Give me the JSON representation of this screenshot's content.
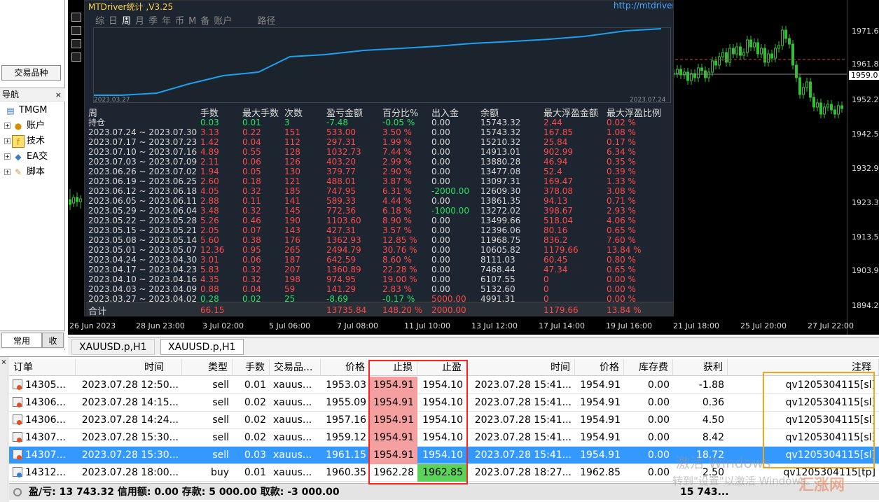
{
  "left_panel": {
    "symbols_button": "交易品种",
    "nav_title": "导航",
    "nav_close": "×",
    "nav_items": [
      {
        "label": "TMGM",
        "icon": "server-icon"
      },
      {
        "label": "账户",
        "icon": "accounts-icon"
      },
      {
        "label": "技术",
        "icon": "indicators-icon"
      },
      {
        "label": "EA交",
        "icon": "expert-advisor-icon"
      },
      {
        "label": "脚本",
        "icon": "scripts-icon"
      }
    ],
    "tabs": [
      "常用",
      "收"
    ]
  },
  "chart": {
    "price_labels": [
      "1971.6",
      "1961.8",
      "1959.0",
      "1952.2",
      "1942.5",
      "1932.9",
      "1923.3",
      "1913.5",
      "1903.9",
      "1894.2"
    ],
    "time_labels": [
      "26 Jun 2023",
      "28 Jun 23:00",
      "3 Jul 02:00",
      "5 Jul 06:00",
      "7 Jul 08:00",
      "11 Jul 10:00",
      "13 Jul 12:00",
      "17 Jul 14:00",
      "19 Jul 16:00",
      "21 Jul 18:00",
      "25 Jul 20:00",
      "27 Jul 22:00"
    ],
    "tabs": [
      "XAUUSD.p,H1",
      "XAUUSD.p,H1"
    ]
  },
  "stats": {
    "title": "MTDriver统计 ,V3.25",
    "url": "http://mtdriver.cn",
    "tabs": [
      "综",
      "日",
      "周",
      "月",
      "季",
      "年",
      "币",
      "M",
      "备",
      "账户",
      "路径"
    ],
    "graph_start": "2023.03.27",
    "graph_end": "2023.07.24",
    "headers": [
      "周",
      "手数",
      "最大手数",
      "次数",
      "盈亏金额",
      "百分比%",
      "出入金",
      "余额",
      "最大浮盈金额",
      "最大浮盈比例"
    ],
    "holding": {
      "label": "持仓",
      "lots": "0.03",
      "max": "0.01",
      "count": "3",
      "pl": "-7.48",
      "pct": "-0.05 %",
      "io": "0.00",
      "bal": "15743.32",
      "fl": "2.44",
      "flp": "0.02 %"
    },
    "rows": [
      {
        "period": "2023.07.24 ~ 2023.07.30",
        "lots": "3.13",
        "max": "0.22",
        "count": "151",
        "pl": "533.00",
        "pct": "3.50 %",
        "io": "0.00",
        "bal": "15743.32",
        "fl": "167.85",
        "flp": "1.08 %"
      },
      {
        "period": "2023.07.17 ~ 2023.07.23",
        "lots": "1.42",
        "max": "0.04",
        "count": "112",
        "pl": "297.31",
        "pct": "1.99 %",
        "io": "0.00",
        "bal": "15210.32",
        "fl": "25.84",
        "flp": "0.17 %"
      },
      {
        "period": "2023.07.10 ~ 2023.07.16",
        "lots": "4.89",
        "max": "0.55",
        "count": "128",
        "pl": "1032.73",
        "pct": "7.44 %",
        "io": "0.00",
        "bal": "14913.01",
        "fl": "902.99",
        "flp": "6.34 %"
      },
      {
        "period": "2023.07.03 ~ 2023.07.09",
        "lots": "2.11",
        "max": "0.06",
        "count": "126",
        "pl": "403.20",
        "pct": "2.99 %",
        "io": "0.00",
        "bal": "13880.28",
        "fl": "46.94",
        "flp": "0.35 %"
      },
      {
        "period": "2023.06.26 ~ 2023.07.02",
        "lots": "1.94",
        "max": "0.05",
        "count": "130",
        "pl": "379.77",
        "pct": "2.90 %",
        "io": "0.00",
        "bal": "13477.08",
        "fl": "52.4",
        "flp": "0.39 %"
      },
      {
        "period": "2023.06.19 ~ 2023.06.25",
        "lots": "2.60",
        "max": "0.18",
        "count": "121",
        "pl": "488.01",
        "pct": "3.87 %",
        "io": "0.00",
        "bal": "13097.31",
        "fl": "169.47",
        "flp": "1.33 %"
      },
      {
        "period": "2023.06.12 ~ 2023.06.18",
        "lots": "4.05",
        "max": "0.32",
        "count": "185",
        "pl": "747.95",
        "pct": "6.31 %",
        "io": "-2000.00",
        "bal": "12609.30",
        "fl": "378.08",
        "flp": "3.08 %"
      },
      {
        "period": "2023.06.05 ~ 2023.06.11",
        "lots": "2.88",
        "max": "0.11",
        "count": "141",
        "pl": "589.33",
        "pct": "4.44 %",
        "io": "0.00",
        "bal": "13861.35",
        "fl": "94.13",
        "flp": "0.71 %"
      },
      {
        "period": "2023.05.29 ~ 2023.06.04",
        "lots": "3.48",
        "max": "0.32",
        "count": "145",
        "pl": "772.36",
        "pct": "6.18 %",
        "io": "-1000.00",
        "bal": "13272.02",
        "fl": "398.67",
        "flp": "2.93 %"
      },
      {
        "period": "2023.05.22 ~ 2023.05.28",
        "lots": "5.26",
        "max": "0.46",
        "count": "190",
        "pl": "1103.60",
        "pct": "8.90 %",
        "io": "0.00",
        "bal": "13499.66",
        "fl": "518.04",
        "flp": "4.06 %"
      },
      {
        "period": "2023.05.15 ~ 2023.05.21",
        "lots": "2.05",
        "max": "0.07",
        "count": "143",
        "pl": "427.31",
        "pct": "3.57 %",
        "io": "0.00",
        "bal": "12396.06",
        "fl": "80.16",
        "flp": "0.65 %"
      },
      {
        "period": "2023.05.08 ~ 2023.05.14",
        "lots": "5.60",
        "max": "0.38",
        "count": "176",
        "pl": "1362.93",
        "pct": "12.85 %",
        "io": "0.00",
        "bal": "11968.75",
        "fl": "836.2",
        "flp": "7.60 %"
      },
      {
        "period": "2023.05.01 ~ 2023.05.07",
        "lots": "12.36",
        "max": "0.95",
        "count": "265",
        "pl": "2494.79",
        "pct": "30.76 %",
        "io": "0.00",
        "bal": "10605.82",
        "fl": "1179.66",
        "flp": "13.84 %"
      },
      {
        "period": "2023.04.24 ~ 2023.04.30",
        "lots": "3.01",
        "max": "0.06",
        "count": "187",
        "pl": "642.59",
        "pct": "8.60 %",
        "io": "0.00",
        "bal": "8111.03",
        "fl": "60.45",
        "flp": "0.80 %"
      },
      {
        "period": "2023.04.17 ~ 2023.04.23",
        "lots": "5.83",
        "max": "0.32",
        "count": "207",
        "pl": "1360.89",
        "pct": "22.28 %",
        "io": "0.00",
        "bal": "7468.44",
        "fl": "47.34",
        "flp": "0.65 %"
      },
      {
        "period": "2023.04.10 ~ 2023.04.16",
        "lots": "4.35",
        "max": "0.32",
        "count": "198",
        "pl": "974.95",
        "pct": "19.00 %",
        "io": "0.00",
        "bal": "6107.55",
        "fl": "0",
        "flp": "0.00 %"
      },
      {
        "period": "2023.04.03 ~ 2023.04.09",
        "lots": "0.88",
        "max": "0.04",
        "count": "59",
        "pl": "141.29",
        "pct": "2.83 %",
        "io": "0.00",
        "bal": "5132.60",
        "fl": "0",
        "flp": "0.00 %"
      },
      {
        "period": "2023.03.27 ~ 2023.04.02",
        "lots": "0.28",
        "max": "0.02",
        "count": "25",
        "pl": "-8.69",
        "pct": "-0.17 %",
        "io": "5000.00",
        "bal": "4991.31",
        "fl": "0",
        "flp": "0.00 %"
      }
    ],
    "total": {
      "label": "合计",
      "lots": "66.15",
      "pl": "13735.84",
      "pct": "148.20 %",
      "io": "2000.00",
      "fl": "1179.66",
      "flp": "13.84 %"
    }
  },
  "table": {
    "headers": {
      "order": "订单",
      "time": "时间",
      "type": "类型",
      "lots": "手数",
      "symbol": "交易品...",
      "price": "价格",
      "sl": "止损",
      "tp": "止盈",
      "time2": "时间",
      "price2": "价格",
      "swap": "库存费",
      "profit": "获利",
      "comment": "注释"
    },
    "rows": [
      {
        "order": "14305...",
        "time": "2023.07.28 12:50...",
        "type": "sell",
        "lots": "0.01",
        "symbol": "xauus...",
        "price": "1953.03",
        "sl": "1954.91",
        "tp": "1954.10",
        "time2": "2023.07.28 15:41...",
        "price2": "1954.91",
        "swap": "0.00",
        "profit": "-1.88",
        "comment": "qv1205304115[sl]"
      },
      {
        "order": "14306...",
        "time": "2023.07.28 14:15...",
        "type": "sell",
        "lots": "0.02",
        "symbol": "xauus...",
        "price": "1955.09",
        "sl": "1954.91",
        "tp": "1954.10",
        "time2": "2023.07.28 15:41...",
        "price2": "1954.91",
        "swap": "0.00",
        "profit": "0.36",
        "comment": "qv1205304115[sl]"
      },
      {
        "order": "14306...",
        "time": "2023.07.28 14:24...",
        "type": "sell",
        "lots": "0.02",
        "symbol": "xauus...",
        "price": "1957.16",
        "sl": "1954.91",
        "tp": "1954.10",
        "time2": "2023.07.28 15:41...",
        "price2": "1954.91",
        "swap": "0.00",
        "profit": "4.50",
        "comment": "qv1205304115[sl]"
      },
      {
        "order": "14307...",
        "time": "2023.07.28 15:30...",
        "type": "sell",
        "lots": "0.02",
        "symbol": "xauus...",
        "price": "1959.12",
        "sl": "1954.91",
        "tp": "1954.10",
        "time2": "2023.07.28 15:41...",
        "price2": "1954.91",
        "swap": "0.00",
        "profit": "8.42",
        "comment": "qv1205304115[sl]"
      },
      {
        "order": "14307...",
        "time": "2023.07.28 15:30...",
        "type": "sell",
        "lots": "0.03",
        "symbol": "xauus...",
        "price": "1961.15",
        "sl": "1954.91",
        "tp": "1954.10",
        "time2": "2023.07.28 15:41...",
        "price2": "1954.91",
        "swap": "0.00",
        "profit": "18.72",
        "comment": "qv1205304115[sl]"
      },
      {
        "order": "14312...",
        "time": "2023.07.28 18:00...",
        "type": "buy",
        "lots": "0.01",
        "symbol": "xauus...",
        "price": "1960.35",
        "sl": "1962.28",
        "tp": "1962.85",
        "time2": "2023.07.28 18:27...",
        "price2": "1962.85",
        "swap": "0.00",
        "profit": "2.50",
        "comment": "qv1205304115[tp]"
      }
    ],
    "summary": "盈/亏: 13 743.32  信用额: 0.00  存款: 5 000.00  取款: -3 000.00",
    "summary_profit": "15 743..."
  },
  "watermark": {
    "line1": "激活 Windows",
    "line2": "转到\"设置\"以激活 Windows。",
    "logo": "汇涨网"
  }
}
